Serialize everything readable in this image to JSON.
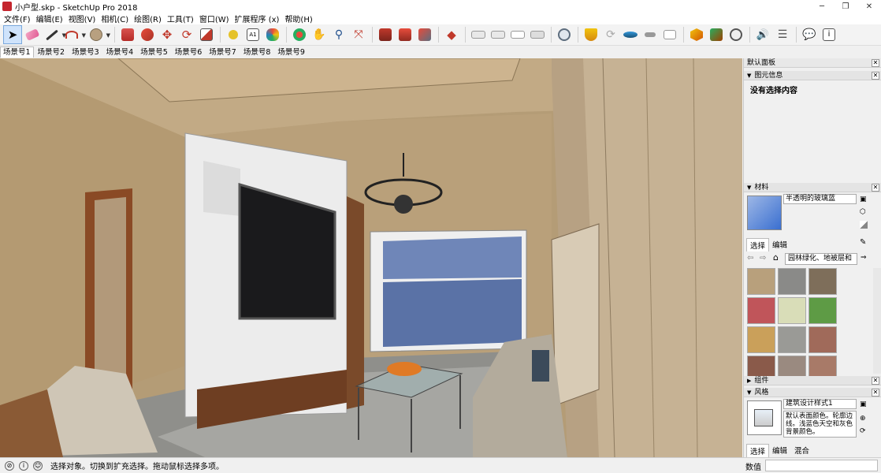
{
  "window": {
    "title": "小户型.skp - SketchUp Pro 2018",
    "minimize_glyph": "─",
    "maximize_glyph": "❐",
    "close_glyph": "✕"
  },
  "menu": [
    "文件(F)",
    "编辑(E)",
    "视图(V)",
    "相机(C)",
    "绘图(R)",
    "工具(T)",
    "窗口(W)",
    "扩展程序 (x)",
    "帮助(H)"
  ],
  "toolbar": {
    "icons": [
      "select-icon",
      "eraser-icon",
      "pencil-icon",
      "arc-icon",
      "shape-icon",
      "push-pull-icon",
      "follow-me-icon",
      "move-icon",
      "rotate-icon",
      "scale-icon",
      "tape-measure-icon",
      "text-icon",
      "paint-bucket-icon",
      "orbit-icon",
      "pan-icon",
      "zoom-icon",
      "zoom-extents-icon",
      "warehouse-icon",
      "extension-warehouse-icon",
      "share-model-icon",
      "ruby-icon",
      "style-xray-icon",
      "style-back-edges-icon",
      "style-wireframe-icon",
      "style-hidden-line-icon",
      "geo-location-icon",
      "sandbox-icon",
      "soften-edges-icon",
      "camera-position-icon",
      "walk-icon",
      "photo-match-icon",
      "section-plane-icon",
      "solid-tools-icon",
      "dynamic-component-icon",
      "sound-icon",
      "settings-icon",
      "chat-icon",
      "info-icon"
    ]
  },
  "scenes": {
    "tabs": [
      "场景号1",
      "场景号2",
      "场景号3",
      "场景号4",
      "场景号5",
      "场景号6",
      "场景号7",
      "场景号8",
      "场景号9"
    ],
    "active_index": 0
  },
  "tray": {
    "title": "默认面板",
    "entity_info": {
      "header": "图元信息",
      "text": "没有选择内容"
    },
    "materials": {
      "header": "材料",
      "material_name": "半透明的玻璃蓝",
      "tab_select": "选择",
      "tab_edit": "编辑",
      "library": "园林绿化、地被层和",
      "swatches": [
        "#b8a07c",
        "#8a8a88",
        "#7e6e5a",
        "#c0555a",
        "#d9ddb8",
        "#5e9b45",
        "#caa05a",
        "#9a9a96",
        "#a06a5a",
        "#8a5a4a",
        "#9a8a80",
        "#a87a68"
      ]
    },
    "components": {
      "header": "组件"
    },
    "styles": {
      "header": "风格",
      "style_name": "建筑设计样式1",
      "description": "默认表面颜色。轮廓边线。浅蓝色天空和灰色背景颜色。",
      "tab_select": "选择",
      "tab_edit": "编辑",
      "tab_mix": "混合"
    }
  },
  "status": {
    "message": "选择对象。切换到扩充选择。拖动鼠标选择多项。",
    "value_label": "数值",
    "value": ""
  }
}
